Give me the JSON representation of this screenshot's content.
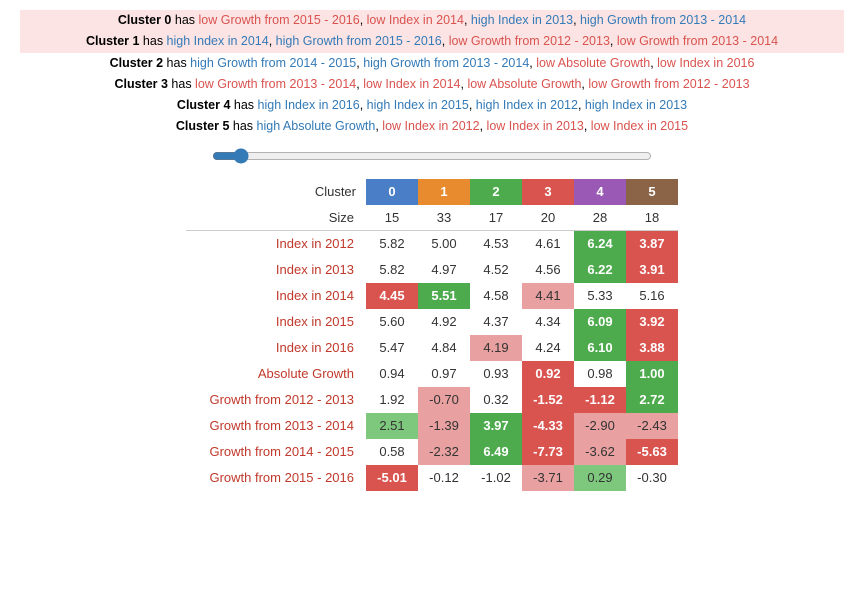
{
  "clusters": {
    "descriptions": [
      {
        "id": 0,
        "text_parts": [
          {
            "text": "Cluster 0",
            "bold": true
          },
          {
            "text": " has "
          },
          {
            "text": "low Growth from 2015 - 2016",
            "color": "red"
          },
          {
            "text": ", "
          },
          {
            "text": "low Index in 2014",
            "color": "red"
          },
          {
            "text": ", "
          },
          {
            "text": "high Index in 2013",
            "color": "blue"
          },
          {
            "text": ", "
          },
          {
            "text": "high Growth from 2013 - 2014",
            "color": "blue"
          }
        ]
      },
      {
        "id": 1,
        "text_parts": [
          {
            "text": "Cluster 1",
            "bold": true
          },
          {
            "text": " has "
          },
          {
            "text": "high Index in 2014",
            "color": "blue"
          },
          {
            "text": ", "
          },
          {
            "text": "high Growth from 2015 - 2016",
            "color": "blue"
          },
          {
            "text": ", "
          },
          {
            "text": "low Growth from 2012 - 2013",
            "color": "red"
          },
          {
            "text": ", "
          },
          {
            "text": "low Growth from 2013 - 2014",
            "color": "red"
          }
        ]
      },
      {
        "id": 2,
        "text_parts": [
          {
            "text": "Cluster 2",
            "bold": true
          },
          {
            "text": " has "
          },
          {
            "text": "high Growth from 2014 - 2015",
            "color": "blue"
          },
          {
            "text": ", "
          },
          {
            "text": "high Growth from 2013 - 2014",
            "color": "blue"
          },
          {
            "text": ", "
          },
          {
            "text": "low Absolute Growth",
            "color": "red"
          },
          {
            "text": ", "
          },
          {
            "text": "low Index in 2016",
            "color": "red"
          }
        ]
      },
      {
        "id": 3,
        "text_parts": [
          {
            "text": "Cluster 3",
            "bold": true
          },
          {
            "text": " has "
          },
          {
            "text": "low Growth from 2013 - 2014",
            "color": "red"
          },
          {
            "text": ", "
          },
          {
            "text": "low Index in 2014",
            "color": "red"
          },
          {
            "text": ", "
          },
          {
            "text": "low Absolute Growth",
            "color": "red"
          },
          {
            "text": ", "
          },
          {
            "text": "low Growth from 2012 - 2013",
            "color": "red"
          }
        ]
      },
      {
        "id": 4,
        "text_parts": [
          {
            "text": "Cluster 4",
            "bold": true
          },
          {
            "text": " has "
          },
          {
            "text": "high Index in 2016",
            "color": "blue"
          },
          {
            "text": ", "
          },
          {
            "text": "high Index in 2015",
            "color": "blue"
          },
          {
            "text": ", "
          },
          {
            "text": "high Index in 2012",
            "color": "blue"
          },
          {
            "text": ", "
          },
          {
            "text": "high Index in 2013",
            "color": "blue"
          }
        ]
      },
      {
        "id": 5,
        "text_parts": [
          {
            "text": "Cluster 5",
            "bold": true
          },
          {
            "text": " has "
          },
          {
            "text": "high Absolute Growth",
            "color": "blue"
          },
          {
            "text": ", "
          },
          {
            "text": "low Index in 2012",
            "color": "red"
          },
          {
            "text": ", "
          },
          {
            "text": "low Index in 2013",
            "color": "red"
          },
          {
            "text": ", "
          },
          {
            "text": "low Index in 2015",
            "color": "red"
          }
        ]
      }
    ]
  },
  "table": {
    "headers": [
      "Cluster",
      "0",
      "1",
      "2",
      "3",
      "4",
      "5"
    ],
    "size_label": "Size",
    "sizes": [
      "15",
      "33",
      "17",
      "20",
      "28",
      "18"
    ],
    "rows": [
      {
        "label": "Index in 2012",
        "values": [
          "5.82",
          "5.00",
          "4.53",
          "4.61",
          "6.24",
          "3.87"
        ],
        "styles": [
          "neutral",
          "neutral",
          "neutral",
          "neutral",
          "high-green",
          "high-red"
        ]
      },
      {
        "label": "Index in 2013",
        "values": [
          "5.82",
          "4.97",
          "4.52",
          "4.56",
          "6.22",
          "3.91"
        ],
        "styles": [
          "neutral",
          "neutral",
          "neutral",
          "neutral",
          "high-green",
          "high-red"
        ]
      },
      {
        "label": "Index in 2014",
        "values": [
          "4.45",
          "5.51",
          "4.58",
          "4.41",
          "5.33",
          "5.16"
        ],
        "styles": [
          "high-red",
          "high-green",
          "neutral",
          "mid-red",
          "neutral",
          "neutral"
        ]
      },
      {
        "label": "Index in 2015",
        "values": [
          "5.60",
          "4.92",
          "4.37",
          "4.34",
          "6.09",
          "3.92"
        ],
        "styles": [
          "neutral",
          "neutral",
          "neutral",
          "neutral",
          "high-green",
          "high-red"
        ]
      },
      {
        "label": "Index in 2016",
        "values": [
          "5.47",
          "4.84",
          "4.19",
          "4.24",
          "6.10",
          "3.88"
        ],
        "styles": [
          "neutral",
          "neutral",
          "mid-red",
          "neutral",
          "high-green",
          "high-red"
        ]
      },
      {
        "label": "Absolute Growth",
        "values": [
          "0.94",
          "0.97",
          "0.93",
          "0.92",
          "0.98",
          "1.00"
        ],
        "styles": [
          "neutral",
          "neutral",
          "neutral",
          "high-red",
          "neutral",
          "high-green"
        ]
      },
      {
        "label": "Growth from 2012 - 2013",
        "values": [
          "1.92",
          "-0.70",
          "0.32",
          "-1.52",
          "-1.12",
          "2.72"
        ],
        "styles": [
          "neutral",
          "mid-red",
          "neutral",
          "high-red",
          "high-red",
          "high-green"
        ]
      },
      {
        "label": "Growth from 2013 - 2014",
        "values": [
          "2.51",
          "-1.39",
          "3.97",
          "-4.33",
          "-2.90",
          "-2.43"
        ],
        "styles": [
          "mid-green",
          "mid-red",
          "high-green",
          "high-red",
          "mid-red",
          "mid-red"
        ]
      },
      {
        "label": "Growth from 2014 - 2015",
        "values": [
          "0.58",
          "-2.32",
          "6.49",
          "-7.73",
          "-3.62",
          "-5.63"
        ],
        "styles": [
          "neutral",
          "mid-red",
          "high-green",
          "high-red",
          "mid-red",
          "high-red"
        ]
      },
      {
        "label": "Growth from 2015 - 2016",
        "values": [
          "-5.01",
          "-0.12",
          "-1.02",
          "-3.71",
          "0.29",
          "-0.30"
        ],
        "styles": [
          "high-red",
          "neutral",
          "neutral",
          "mid-red",
          "mid-green",
          "neutral"
        ]
      }
    ]
  }
}
